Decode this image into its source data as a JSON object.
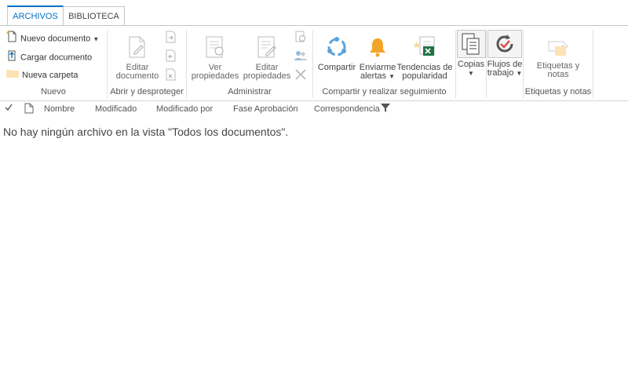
{
  "tabs": {
    "archivos": "ARCHIVOS",
    "biblioteca": "BIBLIOTECA"
  },
  "ribbon": {
    "nuevo": {
      "label": "Nuevo",
      "nuevo_documento": "Nuevo documento",
      "cargar_documento": "Cargar documento",
      "nueva_carpeta": "Nueva carpeta"
    },
    "abrir": {
      "label": "Abrir y desproteger",
      "editar_l1": "Editar",
      "editar_l2": "documento"
    },
    "administrar": {
      "label": "Administrar",
      "ver_l1": "Ver",
      "ver_l2": "propiedades",
      "editar_l1": "Editar",
      "editar_l2": "propiedades"
    },
    "compartir": {
      "label": "Compartir y realizar seguimiento",
      "compartir": "Compartir",
      "alertas_l1": "Enviarme",
      "alertas_l2": "alertas",
      "tendencias_l1": "Tendencias de",
      "tendencias_l2": "popularidad"
    },
    "copias": {
      "label": "Copias"
    },
    "flujos": {
      "label_l1": "Flujos de",
      "label_l2": "trabajo"
    },
    "etiquetas": {
      "label": "Etiquetas y notas",
      "btn_l1": "Etiquetas y",
      "btn_l2": "notas"
    }
  },
  "columns": {
    "nombre": "Nombre",
    "modificado": "Modificado",
    "modificado_por": "Modificado por",
    "fase": "Fase Aprobación",
    "correspondencia": "Correspondencia"
  },
  "empty_message": "No hay ningún archivo en la vista \"Todos los documentos\".",
  "colors": {
    "accent": "#0072c6",
    "orange": "#f2a42b",
    "green": "#217346"
  }
}
